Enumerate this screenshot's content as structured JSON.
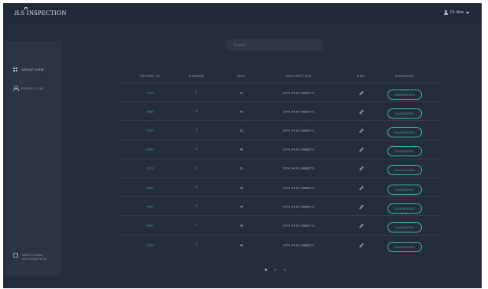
{
  "app": {
    "title": "JLS INSPECTION"
  },
  "user": {
    "name": "Dr. Roe"
  },
  "sidebar": {
    "items": [
      {
        "label": "GROUP VIEW",
        "icon": "grid-icon"
      },
      {
        "label": "PEOPLE LOG",
        "icon": "person-icon"
      }
    ],
    "footer": {
      "line1": "ADDITIONAL",
      "line2": "INFORMATION",
      "icon": "info-icon"
    }
  },
  "search": {
    "placeholder": "Search"
  },
  "table": {
    "headers": [
      "PATIENT ID",
      "GENDER",
      "AGE",
      "DESCRIPTION",
      "EDIT",
      "DIAGNOSE"
    ],
    "rows": [
      {
        "id": "1125",
        "gender": "♀",
        "age": "31",
        "description": "1974.04.02 ABBEYS",
        "diagnose": "DIAGNOSED"
      },
      {
        "id": "4680",
        "gender": "♂",
        "age": "46",
        "description": "1974.04.02 ABBEYS",
        "diagnose": "DIAGNOSE"
      },
      {
        "id": "7534",
        "gender": "♂",
        "age": "31",
        "description": "1974.04.02 ABBEYS",
        "diagnose": "DIAGNOSED"
      },
      {
        "id": "9460",
        "gender": "♂",
        "age": "46",
        "description": "1974.04.02 ABBEYS",
        "diagnose": "DIAGNOSE"
      },
      {
        "id": "2213",
        "gender": "♀",
        "age": "31",
        "description": "1974.04.02 ABBEYS",
        "diagnose": "DIAGNOSED"
      },
      {
        "id": "4680",
        "gender": "♂",
        "age": "46",
        "description": "1974.04.02 ABBEYS",
        "diagnose": "DIAGNOSE"
      },
      {
        "id": "4297",
        "gender": "♂",
        "age": "44",
        "description": "1974.04.02 ABBEYS",
        "diagnose": "DIAGNOSED"
      },
      {
        "id": "5503",
        "gender": "♂",
        "age": "46",
        "description": "1974.04.02 ABBEYS",
        "diagnose": "DIAGNOSE"
      },
      {
        "id": "1303",
        "gender": "♂",
        "age": "44",
        "description": "1974.04.02 ABBEYS",
        "diagnose": "DIAGNOSED"
      }
    ]
  },
  "pagination": {
    "pages": 3,
    "current": 1
  },
  "colors": {
    "background": "#252c3d",
    "topbar": "#222939",
    "sidebar": "#2b3344",
    "accent": "#3fb5a8"
  }
}
